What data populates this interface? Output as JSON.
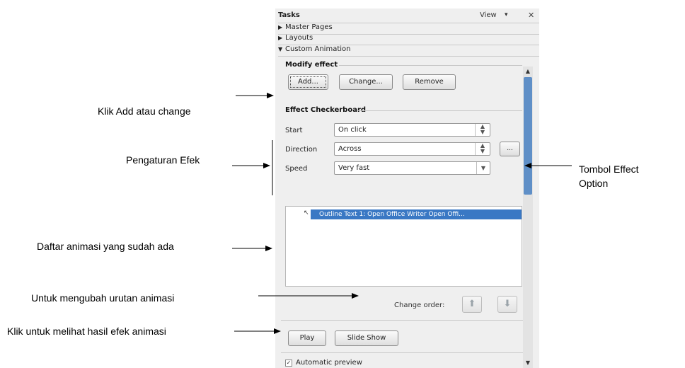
{
  "panel": {
    "title": "Tasks",
    "view_label": "View",
    "view_dropdown_glyph": "▾",
    "close_glyph": "✕",
    "sections": [
      {
        "label": "Master Pages",
        "glyph": "▶"
      },
      {
        "label": "Layouts",
        "glyph": "▶"
      },
      {
        "label": "Custom Animation",
        "glyph": "▼"
      }
    ],
    "modify_effect": {
      "title": "Modify effect",
      "add_label": "Add...",
      "change_label": "Change...",
      "remove_label": "Remove"
    },
    "effect": {
      "title": "Effect Checkerboard",
      "start_label": "Start",
      "start_value": "On click",
      "direction_label": "Direction",
      "direction_value": "Across",
      "speed_label": "Speed",
      "speed_value": "Very fast",
      "options_button_label": "..."
    },
    "animation_list": [
      {
        "label": "Outline Text 1: Open Office Writer Open Offi..."
      }
    ],
    "change_order_label": "Change order:",
    "play_label": "Play",
    "slideshow_label": "Slide Show",
    "automatic_preview_label": "Automatic preview",
    "automatic_preview_checked": true
  },
  "annotations": {
    "add_change": "Klik Add atau change",
    "pengaturan": "Pengaturan Efek",
    "tombol_line1": "Tombol      Effect",
    "tombol_line2": "Option",
    "daftar": "Daftar animasi yang sudah ada",
    "urutan": "Untuk mengubah urutan animasi",
    "klik_play": "Klik untuk melihat hasil efek animasi"
  },
  "colors": {
    "selection": "#3a78c4",
    "scroll_thumb": "#5f8fc7"
  }
}
